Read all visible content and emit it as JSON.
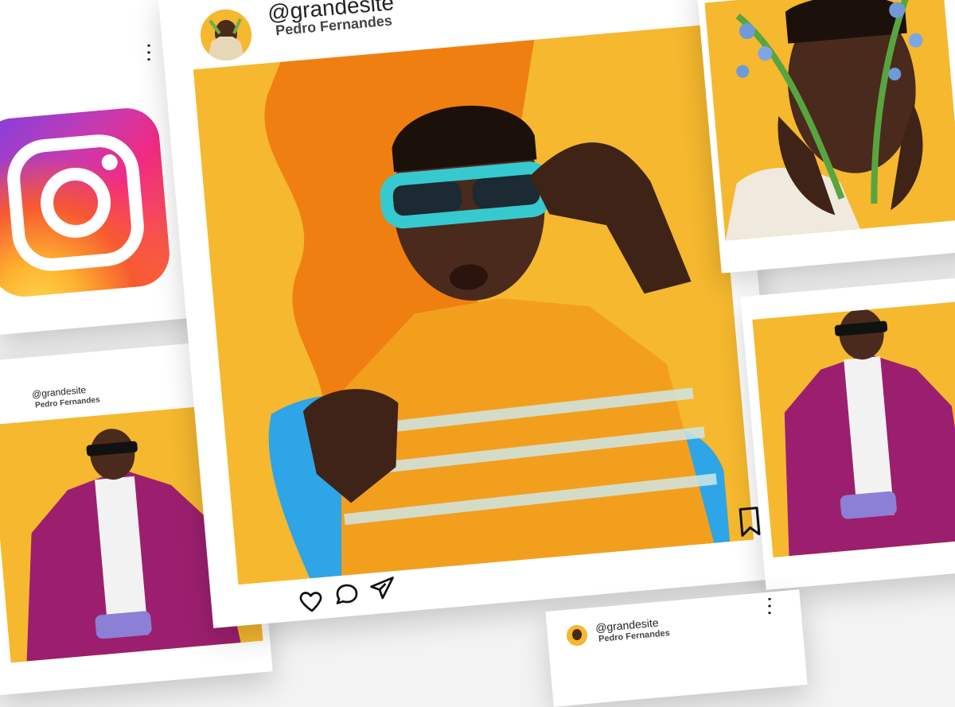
{
  "brand": {
    "app_name": "Instagram",
    "logo_icon": "instagram-logo-icon",
    "accent_colors": [
      "#833ab4",
      "#fd1d1d",
      "#fcb045",
      "#e1306c"
    ]
  },
  "feed": {
    "main_post": {
      "handle": "@grandesite",
      "author": "Pedro Fernandes",
      "photo_alt": "man in striped polo adjusting turquoise glasses against yellow and orange background",
      "actions": {
        "like_icon": "heart-icon",
        "comment_icon": "comment-icon",
        "share_icon": "send-icon",
        "save_icon": "bookmark-icon"
      },
      "menu_icon": "more-options-icon"
    },
    "left_post": {
      "handle": "@grandesite",
      "author": "Pedro Fernandes",
      "photo_alt": "man in magenta jacket with sunglasses"
    },
    "right_top_post": {
      "photo_alt": "man holding blue flowers in front of face"
    },
    "right_bottom_post": {
      "photo_alt": "man in magenta jacket with sunglasses"
    },
    "bottom_post": {
      "handle": "@grandesite",
      "author": "Pedro Fernandes"
    }
  }
}
